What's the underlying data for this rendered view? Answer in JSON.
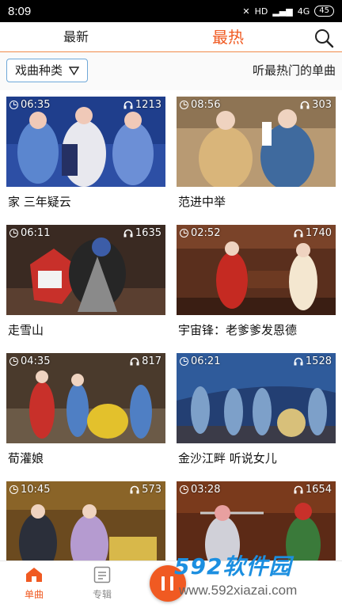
{
  "status": {
    "time": "8:09",
    "network": "4G",
    "hd": "HD",
    "battery": "45"
  },
  "header": {
    "tab_new": "最新",
    "tab_hot": "最热",
    "search_icon": "search-icon"
  },
  "filter": {
    "category_label": "戏曲种类",
    "hint": "听最热门的单曲"
  },
  "items": [
    {
      "duration": "06:35",
      "plays": "1213",
      "title": "家 三年疑云"
    },
    {
      "duration": "08:56",
      "plays": "303",
      "title": "范进中举"
    },
    {
      "duration": "06:11",
      "plays": "1635",
      "title": "走雪山"
    },
    {
      "duration": "02:52",
      "plays": "1740",
      "title": "宇宙锋：老爹爹发恩德"
    },
    {
      "duration": "04:35",
      "plays": "817",
      "title": "荀灌娘"
    },
    {
      "duration": "06:21",
      "plays": "1528",
      "title": "金沙江畔 听说女儿"
    },
    {
      "duration": "10:45",
      "plays": "573",
      "title": ""
    },
    {
      "duration": "03:28",
      "plays": "1654",
      "title": ""
    }
  ],
  "bottom_nav": {
    "songs": "单曲",
    "album": "专辑"
  },
  "watermark": {
    "brand_num": "592",
    "brand_text": "软件园",
    "url": "www.592xiazai.com"
  },
  "colors": {
    "accent": "#f05a22",
    "filter_border": "#6fa8d8",
    "watermark": "#1c8fe0"
  }
}
